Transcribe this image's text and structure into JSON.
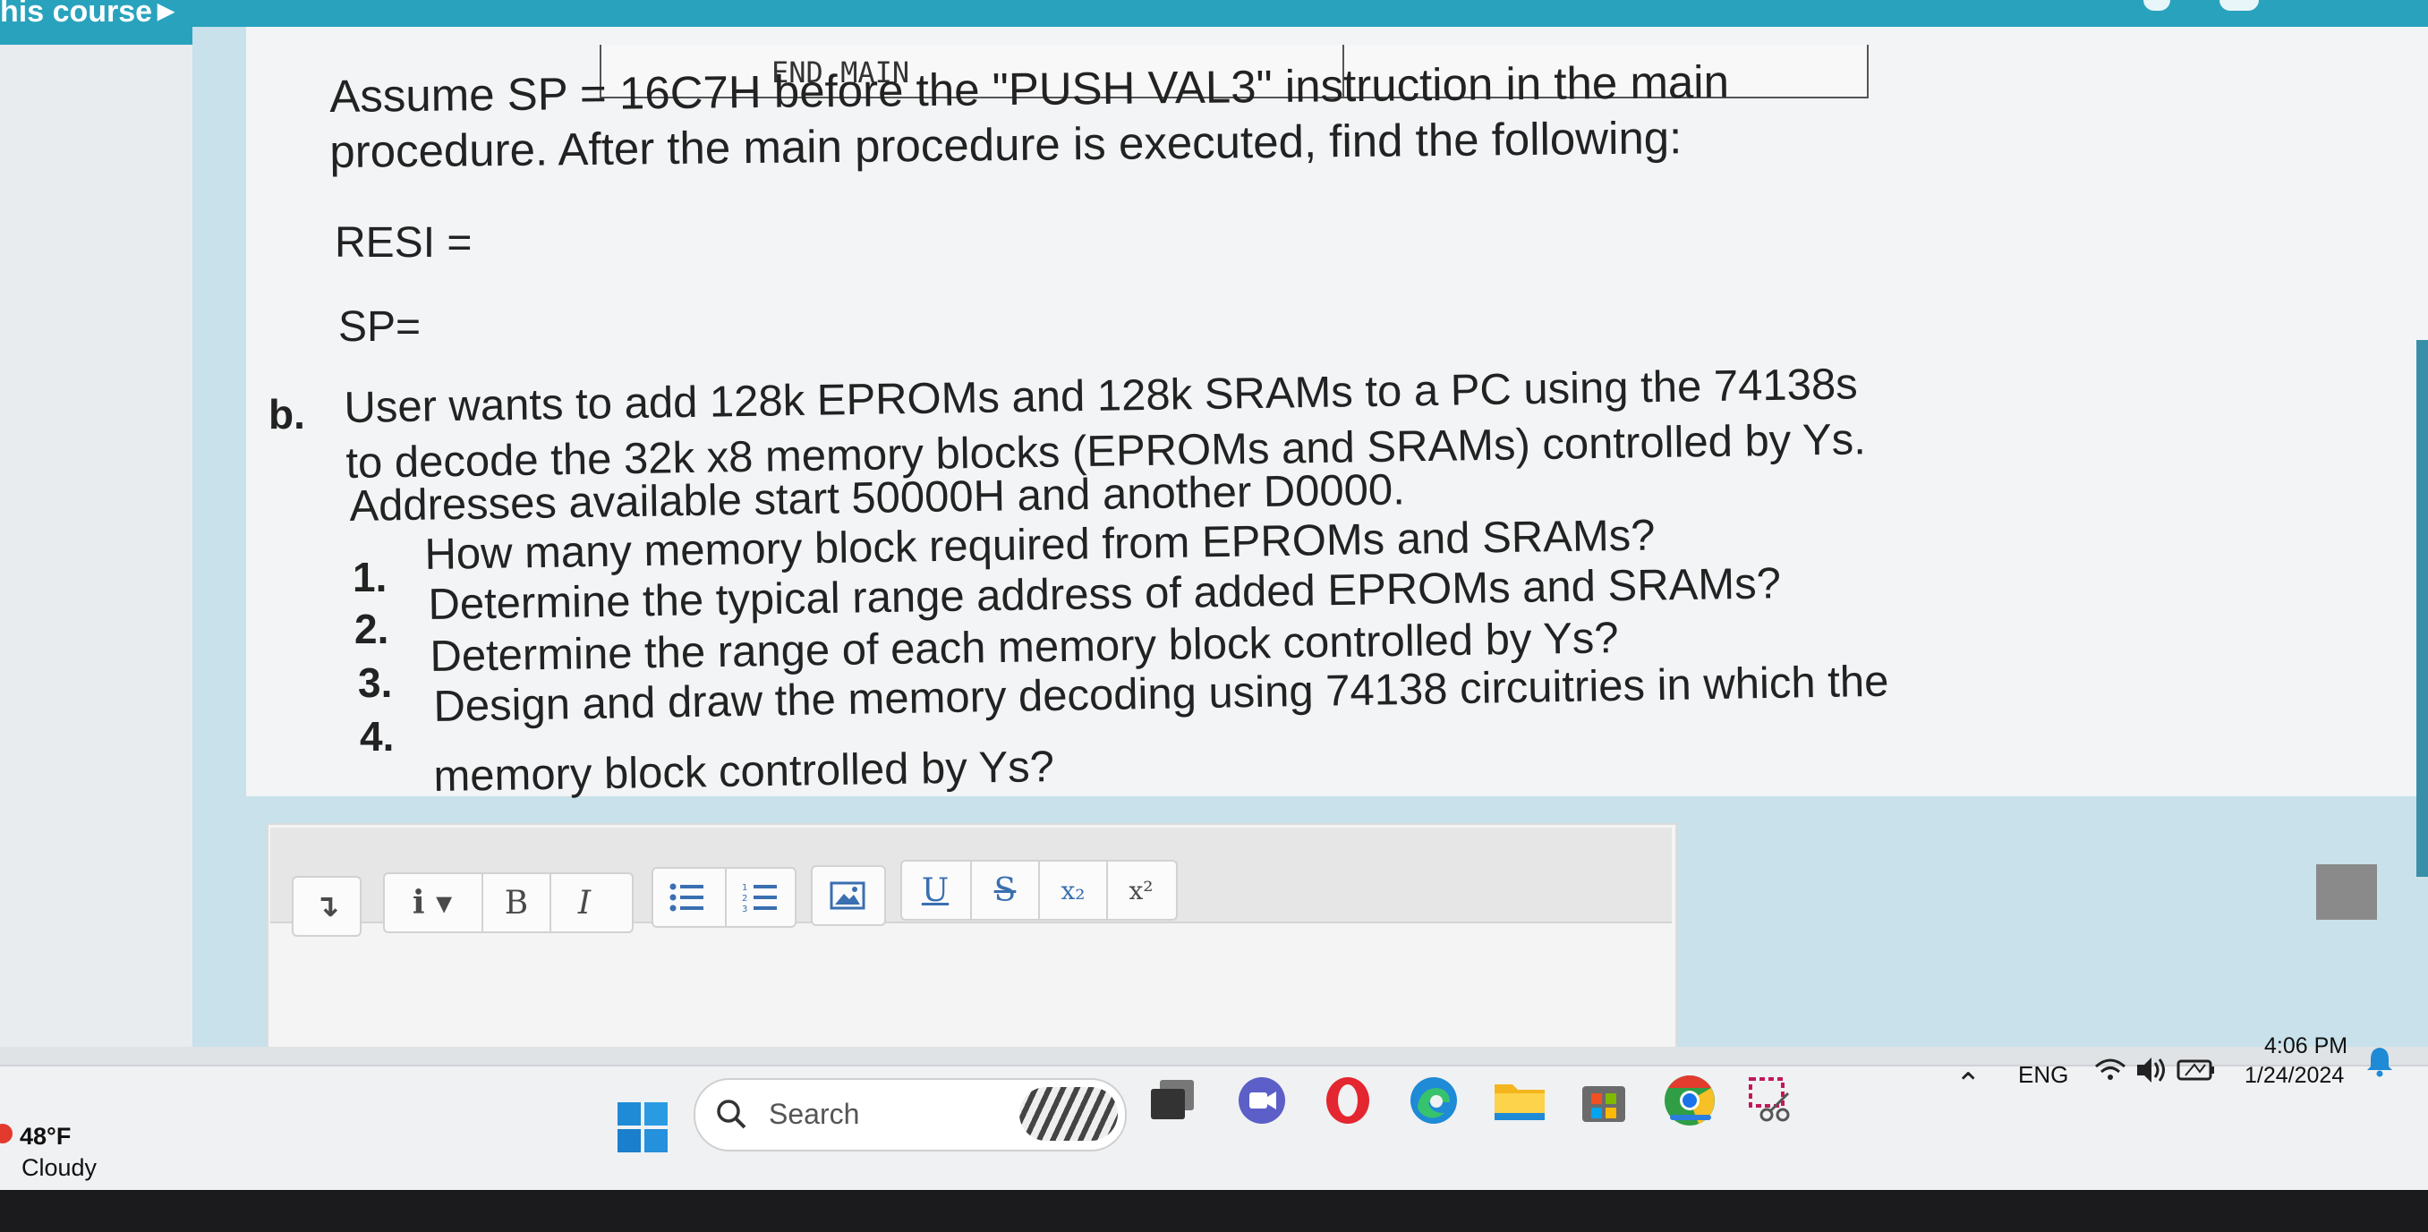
{
  "topbar": {
    "course_link": "his course"
  },
  "code": {
    "end_main": "END MAIN"
  },
  "question": {
    "assume_line1": "Assume  SP  =  16C7H  before  the  \"PUSH  VAL3\"  instruction  in  the  main",
    "assume_line2": "procedure. After the main procedure is executed, find the following:",
    "resi": "RESI =",
    "sp": "SP=",
    "part_b": {
      "label": "b.",
      "line1": "User wants to add 128k EPROMs and 128k SRAMs to a PC using the 74138s",
      "line2": "to decode the 32k x8 memory blocks (EPROMs and SRAMs) controlled by Ys.",
      "line3": "Addresses available start 50000H and another D0000.",
      "items": [
        {
          "num": "1.",
          "text": "How many memory block required from EPROMs and SRAMs?"
        },
        {
          "num": "2.",
          "text": "Determine the typical range address of added EPROMs and SRAMs?"
        },
        {
          "num": "3.",
          "text": "Determine the range of each memory block controlled by Ys?"
        },
        {
          "num": "4.",
          "text": "Design and draw the memory decoding using 74138 circuitries in which the"
        }
      ],
      "item4_cont": "memory block controlled by Ys?"
    }
  },
  "toolbar": {
    "expand": "↴",
    "info": "i ▾",
    "bold": "B",
    "italic": "I",
    "underline": "U",
    "strike": "S",
    "subscript": "x₂",
    "superscript": "x²"
  },
  "taskbar": {
    "weather_temp": "48°F",
    "weather_desc": "Cloudy",
    "search_placeholder": "Search",
    "tray_lang": "ENG",
    "time": "4:06 PM",
    "date": "1/24/2024"
  },
  "colors": {
    "topbar": "#29a3bd",
    "page_frame": "#c8e1ea",
    "opera_red": "#e3262f",
    "edge_blue": "#1f8ad6",
    "chrome_green": "#2f9e44"
  }
}
